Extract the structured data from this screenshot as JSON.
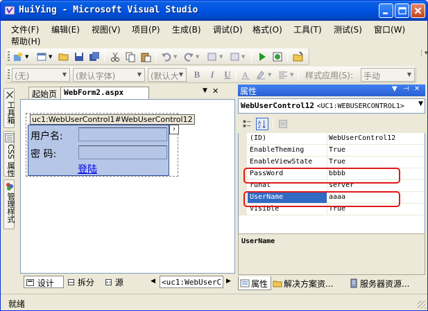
{
  "window": {
    "title": "HuiYing - Microsoft Visual Studio"
  },
  "menu": {
    "row1": [
      "文件(F)",
      "编辑(E)",
      "视图(V)",
      "项目(P)",
      "生成(B)",
      "调试(D)",
      "格式(O)",
      "工具(T)",
      "测试(S)",
      "窗口(W)"
    ],
    "row2": [
      "帮助(H)"
    ]
  },
  "format_toolbar": {
    "block_format": "(无)",
    "font_name": "(默认字体)",
    "font_size": "(默认大",
    "bold": "B",
    "italic": "I",
    "underline": "U",
    "style_apply_label": "样式应用(S):",
    "style_mode": "手动"
  },
  "left_strip": {
    "toolbox": "工具箱",
    "css_props": "CSS 属性",
    "manage_styles": "管理样式"
  },
  "document": {
    "tabs": [
      "起始页",
      "WebForm2.aspx"
    ],
    "usercontrol": {
      "caption": "uc1:WebUserControl1#WebUserControl12",
      "username_label": "用户名:",
      "password_label": "密 码:",
      "login_link": "登陆"
    },
    "view_buttons": [
      "设计",
      "拆分",
      "源"
    ],
    "path_crumb": "<uc1:WebUserC"
  },
  "properties": {
    "title": "属性",
    "object_name": "WebUserControl12",
    "object_type": "<UC1:WEBUSERCONTROL1>",
    "rows": [
      {
        "name": "(ID)",
        "value": "WebUserControl12"
      },
      {
        "name": "EnableTheming",
        "value": "True"
      },
      {
        "name": "EnableViewState",
        "value": "True"
      },
      {
        "name": "PassWord",
        "value": "bbbb"
      },
      {
        "name": "runat",
        "value": "server"
      },
      {
        "name": "UserName",
        "value": "aaaa"
      },
      {
        "name": "Visible",
        "value": "True"
      }
    ],
    "description_title": "UserName",
    "bottom_tabs": [
      "属性",
      "解决方案资...",
      "服务器资源..."
    ]
  },
  "status": {
    "text": "就绪"
  },
  "colors": {
    "titlebar": "#0054e3",
    "selection": "#316ac5",
    "highlight_box": "#e01818",
    "usercontrol_bg": "#b6c6e7"
  }
}
